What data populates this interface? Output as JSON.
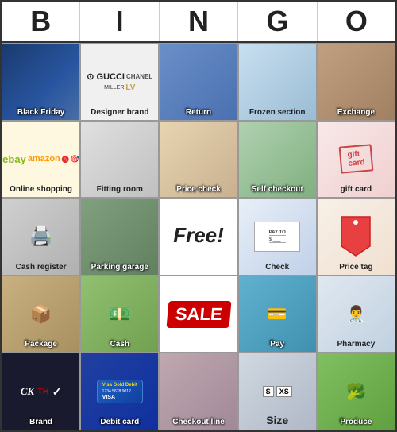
{
  "header": {
    "letters": [
      "B",
      "I",
      "N",
      "G",
      "O"
    ]
  },
  "cells": [
    {
      "id": "black-friday",
      "label": "Black Friday",
      "bg": "bg-black-friday",
      "labelDark": false
    },
    {
      "id": "designer-brand",
      "label": "Designer brand",
      "bg": "bg-designer-brand",
      "labelDark": true
    },
    {
      "id": "return",
      "label": "Return",
      "bg": "bg-return",
      "labelDark": false
    },
    {
      "id": "frozen-section",
      "label": "Frozen section",
      "bg": "bg-frozen",
      "labelDark": true
    },
    {
      "id": "exchange",
      "label": "Exchange",
      "bg": "bg-exchange",
      "labelDark": false
    },
    {
      "id": "online-shopping",
      "label": "Online shopping",
      "bg": "bg-online-shopping",
      "labelDark": false
    },
    {
      "id": "fitting-room",
      "label": "Fitting room",
      "bg": "bg-fitting-room",
      "labelDark": true
    },
    {
      "id": "price-check",
      "label": "Price check",
      "bg": "bg-price-check",
      "labelDark": false
    },
    {
      "id": "self-checkout",
      "label": "Self checkout",
      "bg": "bg-self-checkout",
      "labelDark": false
    },
    {
      "id": "gift-card",
      "label": "gift card",
      "bg": "bg-gift-card",
      "labelDark": true
    },
    {
      "id": "cash-register",
      "label": "Cash register",
      "bg": "bg-cash-register",
      "labelDark": true
    },
    {
      "id": "parking-garage",
      "label": "Parking garage",
      "bg": "bg-parking",
      "labelDark": false
    },
    {
      "id": "free",
      "label": "Free!",
      "bg": "bg-free",
      "labelDark": true,
      "special": "free"
    },
    {
      "id": "check",
      "label": "Check",
      "bg": "bg-check",
      "labelDark": true
    },
    {
      "id": "price-tag",
      "label": "Price tag",
      "bg": "bg-price-tag",
      "labelDark": true,
      "special": "price-tag"
    },
    {
      "id": "package",
      "label": "Package",
      "bg": "bg-package",
      "labelDark": false
    },
    {
      "id": "cash",
      "label": "Cash",
      "bg": "bg-cash",
      "labelDark": false
    },
    {
      "id": "sale",
      "label": "",
      "bg": "bg-sale",
      "labelDark": true,
      "special": "sale"
    },
    {
      "id": "pay",
      "label": "Pay",
      "bg": "bg-pay",
      "labelDark": false
    },
    {
      "id": "pharmacy",
      "label": "Pharmacy",
      "bg": "bg-pharmacy",
      "labelDark": true
    },
    {
      "id": "brand",
      "label": "Brand",
      "bg": "bg-brand",
      "labelDark": false
    },
    {
      "id": "debit-card",
      "label": "Debit card",
      "bg": "bg-debit",
      "labelDark": false
    },
    {
      "id": "checkout-line",
      "label": "Checkout line",
      "bg": "bg-checkout-line",
      "labelDark": false
    },
    {
      "id": "size",
      "label": "Size",
      "bg": "bg-size",
      "labelDark": true
    },
    {
      "id": "produce",
      "label": "Produce",
      "bg": "bg-produce",
      "labelDark": false
    }
  ]
}
